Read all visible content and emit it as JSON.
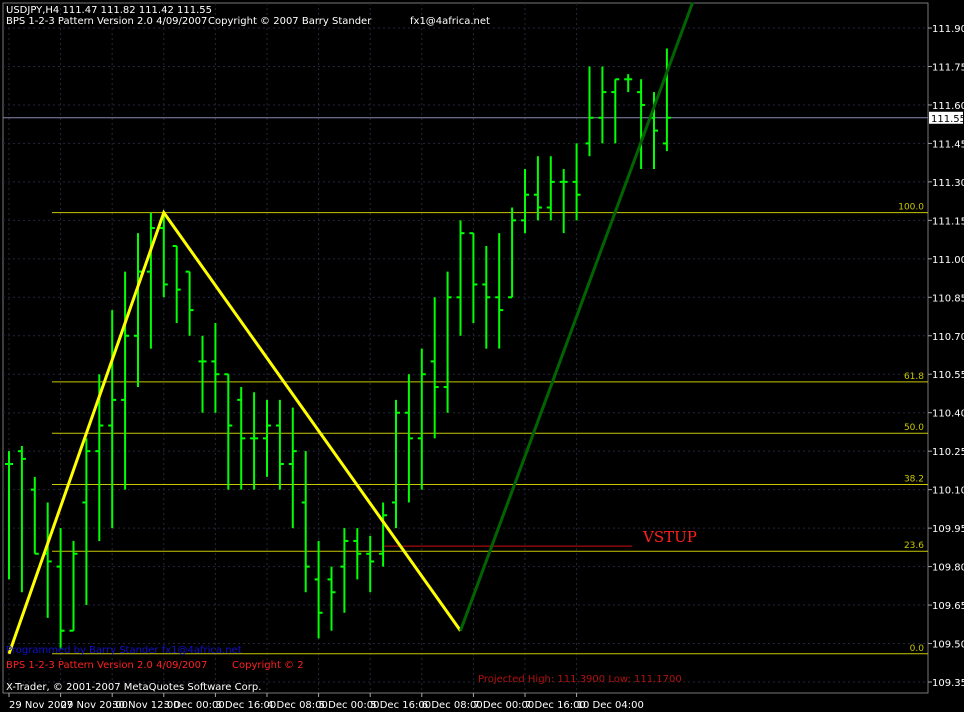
{
  "header": {
    "symbol_line": "USDJPY,H4  111.47 111.82 111.42 111.55",
    "indicator_line": "BPS 1-2-3 Pattern  Version 2.0  4/09/2007",
    "copyright": "Copyright © 2007 Barry Stander",
    "email": "fx1@4africa.net"
  },
  "colors": {
    "background": "#000000",
    "grid": "#26263a",
    "bars": "#00ff00",
    "zigzag": "#ffff00",
    "trend_line": "#006400",
    "fib_lines": "#c8c800",
    "label_red": "#ff2020",
    "info_blue": "#1010cc",
    "axis_text": "#ffffff",
    "current_price_line": "#8a8ab0"
  },
  "signal": {
    "label": "VSTUP"
  },
  "footer": {
    "line1": "Programmed by Barry Stander    fx1@4africa.net",
    "line2_left": "BPS 1-2-3 Pattern  Version 2.0  4/09/2007",
    "line2_right": "Copyright © 2",
    "line3_info": "Projected High: 111.3900   Low: 111.1700",
    "line4": "X-Trader, © 2001-2007 MetaQuotes Software Corp."
  },
  "chart_data": {
    "type": "bar",
    "title": "USDJPY,H4",
    "y_ticks": [
      "111.90",
      "111.75",
      "111.60",
      "111.45",
      "111.30",
      "111.15",
      "111.00",
      "110.85",
      "110.70",
      "110.55",
      "110.40",
      "110.25",
      "110.10",
      "109.95",
      "109.80",
      "109.65",
      "109.50",
      "109.35"
    ],
    "ylim": [
      109.3,
      111.98
    ],
    "current_price": "111.55",
    "x_ticks": [
      {
        "label": "29 Nov 2007",
        "bar": 0
      },
      {
        "label": "29 Nov 20:00",
        "bar": 4
      },
      {
        "label": "30 Nov 12:00",
        "bar": 8
      },
      {
        "label": "3 Dec 00:00",
        "bar": 12
      },
      {
        "label": "3 Dec 16:00",
        "bar": 16
      },
      {
        "label": "4 Dec 08:00",
        "bar": 20
      },
      {
        "label": "5 Dec 00:00",
        "bar": 24
      },
      {
        "label": "5 Dec 16:00",
        "bar": 28
      },
      {
        "label": "6 Dec 08:00",
        "bar": 32
      },
      {
        "label": "7 Dec 00:00",
        "bar": 36
      },
      {
        "label": "7 Dec 16:00",
        "bar": 40
      },
      {
        "label": "10 Dec 04:00",
        "bar": 44
      }
    ],
    "ohlc": [
      [
        110.2,
        110.25,
        109.75,
        110.2
      ],
      [
        110.25,
        110.27,
        109.7,
        110.22
      ],
      [
        110.1,
        110.15,
        109.85,
        109.85
      ],
      [
        109.85,
        110.05,
        109.6,
        109.82
      ],
      [
        109.8,
        109.95,
        109.48,
        109.55
      ],
      [
        109.55,
        109.9,
        109.55,
        109.85
      ],
      [
        110.05,
        110.3,
        109.65,
        110.25
      ],
      [
        110.25,
        110.55,
        109.9,
        110.35
      ],
      [
        110.35,
        110.8,
        109.95,
        110.45
      ],
      [
        110.45,
        110.95,
        110.1,
        110.7
      ],
      [
        110.7,
        111.1,
        110.5,
        110.95
      ],
      [
        110.95,
        111.18,
        110.65,
        111.12
      ],
      [
        111.12,
        111.18,
        110.85,
        110.9
      ],
      [
        111.05,
        111.05,
        110.75,
        110.88
      ],
      [
        110.95,
        110.95,
        110.7,
        110.8
      ],
      [
        110.6,
        110.7,
        110.4,
        110.6
      ],
      [
        110.6,
        110.75,
        110.4,
        110.55
      ],
      [
        110.55,
        110.55,
        110.1,
        110.35
      ],
      [
        110.45,
        110.5,
        110.1,
        110.3
      ],
      [
        110.3,
        110.48,
        110.1,
        110.3
      ],
      [
        110.3,
        110.45,
        110.15,
        110.35
      ],
      [
        110.35,
        110.45,
        110.1,
        110.2
      ],
      [
        110.2,
        110.42,
        109.95,
        110.25
      ],
      [
        110.05,
        110.25,
        109.7,
        109.8
      ],
      [
        109.75,
        109.9,
        109.52,
        109.62
      ],
      [
        109.75,
        109.8,
        109.55,
        109.7
      ],
      [
        109.8,
        109.95,
        109.62,
        109.9
      ],
      [
        109.9,
        109.95,
        109.75,
        109.85
      ],
      [
        109.85,
        109.92,
        109.7,
        109.82
      ],
      [
        109.85,
        110.05,
        109.8,
        110.0
      ],
      [
        110.05,
        110.45,
        109.95,
        110.4
      ],
      [
        110.4,
        110.55,
        110.05,
        110.3
      ],
      [
        110.3,
        110.65,
        110.1,
        110.55
      ],
      [
        110.6,
        110.85,
        110.3,
        110.5
      ],
      [
        110.5,
        110.95,
        110.4,
        110.85
      ],
      [
        110.85,
        111.15,
        110.7,
        111.1
      ],
      [
        111.1,
        111.1,
        110.75,
        110.9
      ],
      [
        110.9,
        111.05,
        110.65,
        110.85
      ],
      [
        110.85,
        111.1,
        110.65,
        110.8
      ],
      [
        110.85,
        111.2,
        110.85,
        111.15
      ],
      [
        111.15,
        111.35,
        111.1,
        111.25
      ],
      [
        111.25,
        111.4,
        111.15,
        111.2
      ],
      [
        111.2,
        111.4,
        111.15,
        111.3
      ],
      [
        111.3,
        111.35,
        111.1,
        111.3
      ],
      [
        111.3,
        111.45,
        111.15,
        111.25
      ],
      [
        111.45,
        111.75,
        111.4,
        111.55
      ],
      [
        111.55,
        111.75,
        111.45,
        111.65
      ],
      [
        111.65,
        111.7,
        111.45,
        111.7
      ],
      [
        111.7,
        111.72,
        111.65,
        111.7
      ],
      [
        111.65,
        111.7,
        111.35,
        111.6
      ],
      [
        111.55,
        111.65,
        111.35,
        111.5
      ],
      [
        111.45,
        111.82,
        111.42,
        111.55
      ]
    ],
    "fibonacci": [
      {
        "label": "100.0",
        "price": 111.18
      },
      {
        "label": "61.8",
        "price": 110.52
      },
      {
        "label": "50.0",
        "price": 110.32
      },
      {
        "label": "38.2",
        "price": 110.12
      },
      {
        "label": "23.6",
        "price": 109.86
      },
      {
        "label": "0.0",
        "price": 109.46
      }
    ],
    "zigzag": [
      {
        "bar": 0,
        "price": 109.46
      },
      {
        "bar": 12,
        "price": 111.18
      },
      {
        "bar": 35,
        "price": 109.55
      }
    ],
    "trend_line": [
      {
        "bar": 35,
        "price": 109.55
      },
      {
        "bar": 53,
        "price": 112.0
      }
    ],
    "signal_level": 109.88,
    "xlabel": "",
    "ylabel": ""
  }
}
